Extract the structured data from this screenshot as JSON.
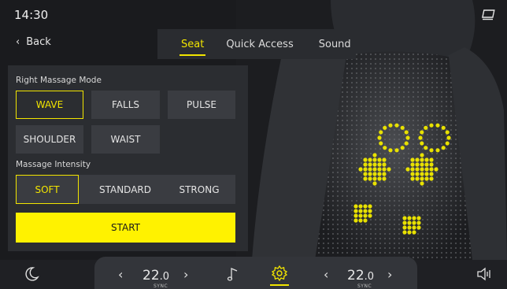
{
  "status": {
    "time": "14:30"
  },
  "nav": {
    "back_label": "Back"
  },
  "tabs": [
    {
      "label": "Seat",
      "active": true
    },
    {
      "label": "Quick Access",
      "active": false
    },
    {
      "label": "Sound",
      "active": false
    }
  ],
  "massage": {
    "mode_title": "Right Massage Mode",
    "modes": [
      "WAVE",
      "FALLS",
      "PULSE",
      "SHOULDER",
      "WAIST"
    ],
    "selected_mode": "WAVE",
    "intensity_title": "Massage Intensity",
    "intensities": [
      "SOFT",
      "STANDARD",
      "STRONG"
    ],
    "selected_intensity": "SOFT",
    "start_label": "START"
  },
  "climate": {
    "left": {
      "temp": "22",
      "decimal": ".0",
      "sync": "SYNC"
    },
    "right": {
      "temp": "22",
      "decimal": ".0",
      "sync": "SYNC"
    }
  },
  "bottom_icons": [
    "moon-icon",
    "chevron-left-icon",
    "chevron-right-icon",
    "music-note-icon",
    "gear-icon",
    "volume-icon"
  ],
  "colors": {
    "accent": "#f2e500",
    "start_bg": "#fff200",
    "panel": "#2b2d31",
    "button": "#3a3c41"
  }
}
